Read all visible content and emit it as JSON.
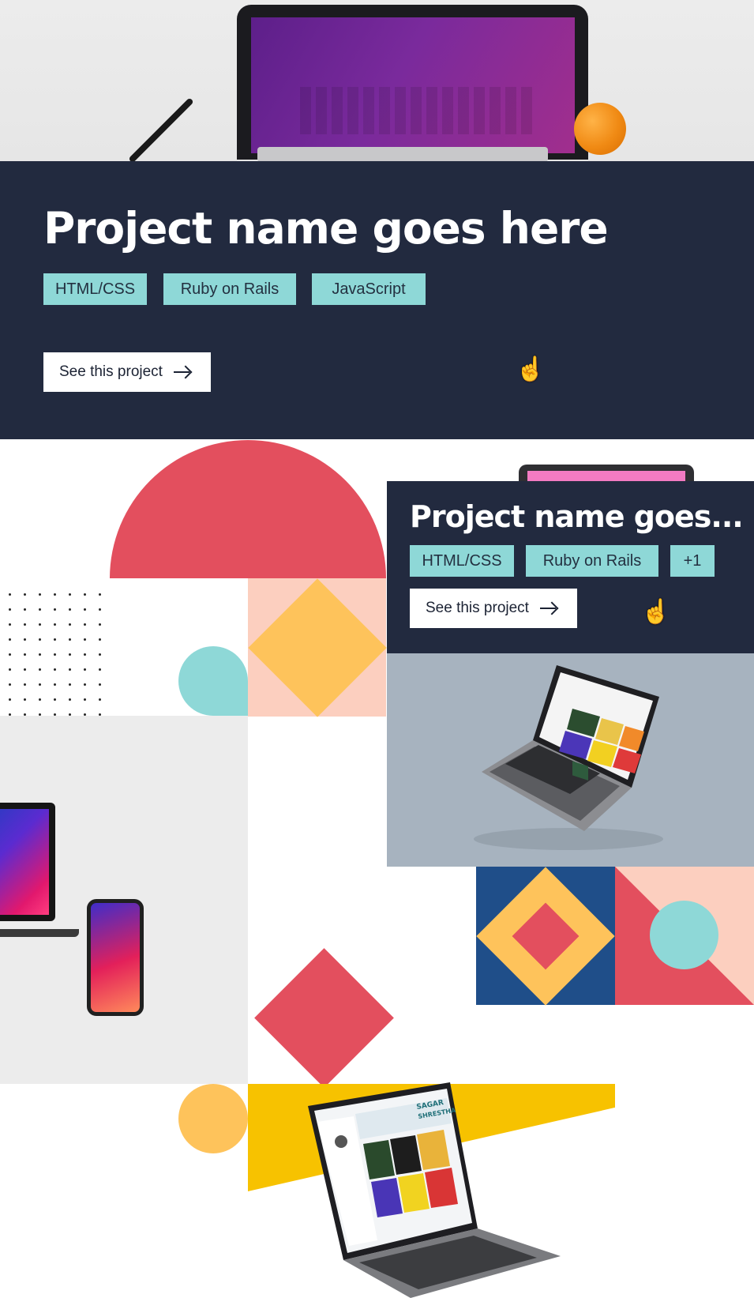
{
  "project_large": {
    "title": "Project name goes here",
    "tags": [
      "HTML/CSS",
      "Ruby on Rails",
      "JavaScript"
    ],
    "button_label": "See this project"
  },
  "project_small": {
    "title": "Project name goes...",
    "tags": [
      "HTML/CSS",
      "Ruby on Rails",
      "+1"
    ],
    "button_label": "See this project"
  },
  "mockup_text": {
    "brand": "SAGAR",
    "brand_sub": "SHRESTHA"
  },
  "colors": {
    "navy": "#222a3f",
    "teal": "#8ed8d7",
    "red": "#e34f5e",
    "yellow": "#fec35b",
    "peach": "#fccfbf",
    "blue": "#1f4e89"
  },
  "icons": [
    "arrow-right-icon",
    "hand-pointer-icon"
  ]
}
